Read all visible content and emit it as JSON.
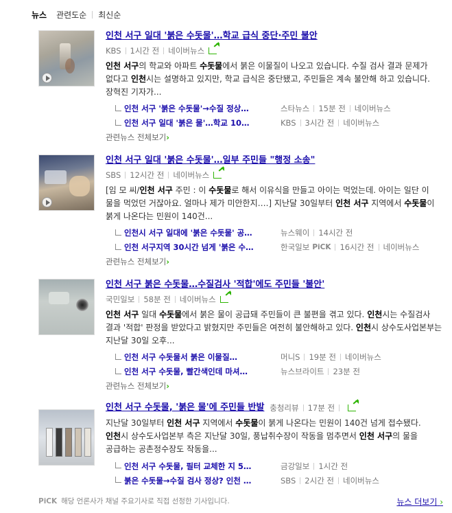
{
  "tabs": [
    {
      "label": "뉴스",
      "active": true
    },
    {
      "label": "관련도순",
      "active": false
    },
    {
      "label": "최신순",
      "active": false
    }
  ],
  "articles": [
    {
      "title_kw": "인천 서구",
      "title_rest": " 일대 '붉은 수돗물'…학교 급식 중단·주민 불안",
      "source": "KBS",
      "time": "1시간 전",
      "naver": "네이버뉴스",
      "snippet_html": "<b>인천 서구</b>의 학교와 아파트 <b>수돗물</b>에서 붉은 이물질이 나오고 있습니다. 수질 검사 결과 문제가 없다고 <b>인천</b>시는 설명하고 있지만, 학교 급식은 중단됐고, 주민들은 계속 불안해 하고 있습니다. 장혁진 기자가...",
      "related": [
        {
          "title": "인천 서구 '붉은 수돗물'→수질 정상…",
          "source": "스타뉴스",
          "time": "15분 전",
          "naver": "네이버뉴스",
          "pick": false
        },
        {
          "title": "인천 서구 일대 '붉은 물'…학교 10…",
          "source": "KBS",
          "time": "3시간 전",
          "naver": "네이버뉴스",
          "pick": false
        }
      ],
      "more_label": "관련뉴스 전체보기"
    },
    {
      "title_kw": "인천 서구",
      "title_rest": " 일대 '붉은 수돗물'…일부 주민들 \"행정 소송\"",
      "source": "SBS",
      "time": "12시간 전",
      "naver": "네이버뉴스",
      "snippet_html": "[임 모 씨/<b>인천 서구</b> 주민 : 이 <b>수돗물</b>로 해서 이유식을 만들고 아이는 먹었는데. 아이는 일단 이 물을 먹었던 거잖아요. 얼마나 제가 미안한지….] 지난달 30일부터 <b>인천 서구</b> 지역에서 <b>수돗물</b>이 붉게 나온다는 민원이 140건...",
      "related": [
        {
          "title": "인천시 서구 일대에 '붉은 수돗물' 공…",
          "source": "뉴스웨이",
          "time": "14시간 전",
          "naver": "",
          "pick": false
        },
        {
          "title": "인천 서구지역 30시간 넘게 '붉은 수…",
          "source": "한국일보",
          "time": "16시간 전",
          "naver": "네이버뉴스",
          "pick": true
        }
      ],
      "more_label": "관련뉴스 전체보기"
    },
    {
      "title_kw": "인천 서구",
      "title_rest": " 붉은 수돗물…수질검사 '적합'에도 주민들 '불안'",
      "source": "국민일보",
      "time": "58분 전",
      "naver": "네이버뉴스",
      "snippet_html": "<b>인천 서구</b> 일대 <b>수돗물</b>에서 붉은 물이 공급돼 주민들이 큰 불편을 겪고 있다. <b>인천</b>시는 수질검사 결과 '적합' 판정을 받았다고 밝혔지만 주민들은 여전히 불안해하고 있다. <b>인천</b>시 상수도사업본부는 지난달 30일 오후...",
      "related": [
        {
          "title": "인천 서구 수돗물서 붉은 이물질…",
          "source": "머니S",
          "time": "19분 전",
          "naver": "네이버뉴스",
          "pick": false
        },
        {
          "title": "인천 서구 수돗물, 빨간색인데 마셔…",
          "source": "뉴스브라이트",
          "time": "23분 전",
          "naver": "",
          "pick": false
        }
      ],
      "more_label": "관련뉴스 전체보기"
    },
    {
      "title_kw": "인천 서구 수돗물",
      "title_rest": ", '붉은 물'에 주민들 반발",
      "source": "충청리뷰",
      "time": "17분 전",
      "naver": "",
      "snippet_html": "지난달 30일부터 <b>인천 서구</b> 지역에서 <b>수돗물</b>이 붉게 나온다는 민원이 140건 넘게 접수됐다. <b>인천</b>시 상수도사업본부 측은 지난달 30일, 풍납취수장이 작동을 멈추면서 <b>인천 서구</b>의 물을 공급하는 공촌정수장도 작동을...",
      "related": [
        {
          "title": "인천 서구 수돗물, 필터 교체한 지 5…",
          "source": "금강일보",
          "time": "1시간 전",
          "naver": "",
          "pick": false
        },
        {
          "title": "붉은 수돗물→수질 검사 정상? 인천 …",
          "source": "SBS",
          "time": "2시간 전",
          "naver": "네이버뉴스",
          "pick": false
        }
      ],
      "more_label": ""
    }
  ],
  "footer": {
    "pick_label": "PiCK",
    "pick_desc": "해당 언론사가 채널 주요기사로 직접 선정한 기사입니다.",
    "more_label": "뉴스 더보기"
  },
  "icons": {
    "share": "share-icon",
    "play": "play-icon"
  },
  "colors": {
    "link": "#1a0dab",
    "accent": "#2db400"
  }
}
